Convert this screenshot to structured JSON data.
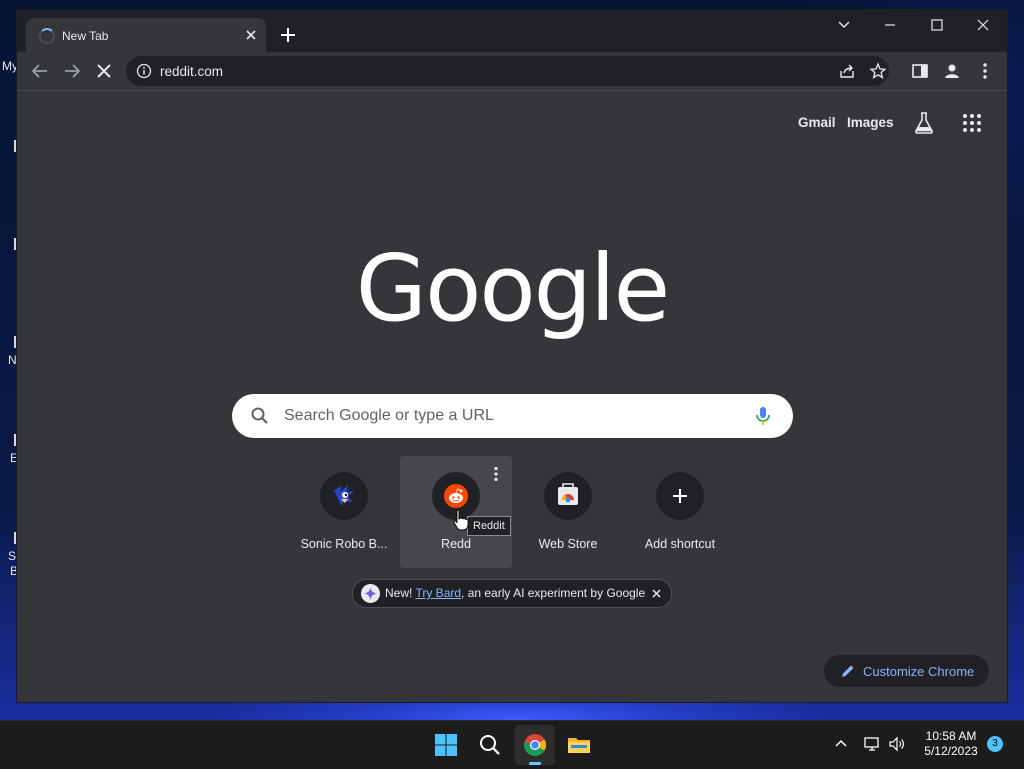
{
  "desktop": {
    "icon_label_fragments": [
      "My",
      "N",
      "E",
      "Sc",
      "B"
    ]
  },
  "browser": {
    "tab": {
      "title": "New Tab",
      "loading": true
    },
    "omnibox": {
      "url": "reddit.com"
    },
    "icons": {
      "back": "arrow-left-icon",
      "forward": "arrow-right-icon",
      "stop": "close-icon",
      "site_info": "info-icon",
      "share": "share-icon",
      "bookmark": "star-icon",
      "side_panel": "side-panel-icon",
      "profile": "profile-icon",
      "menu": "kebab-menu-icon"
    }
  },
  "ntp": {
    "top_links": {
      "gmail": "Gmail",
      "images": "Images"
    },
    "logo_text": "Google",
    "search": {
      "placeholder": "Search Google or type a URL"
    },
    "shortcuts": [
      {
        "label": "Sonic Robo B...",
        "icon": "sonic-favicon"
      },
      {
        "label": "Redd",
        "icon": "reddit-favicon",
        "hovered": true
      },
      {
        "label": "Web Store",
        "icon": "chrome-web-store-favicon"
      },
      {
        "label": "Add shortcut",
        "icon": "plus-icon"
      }
    ],
    "tooltip": "Reddit",
    "promo": {
      "prefix": "New!",
      "link": "Try Bard",
      "suffix": ", an early AI experiment by Google"
    },
    "customize_label": "Customize Chrome"
  },
  "taskbar": {
    "apps": [
      "windows-start",
      "search",
      "google-chrome",
      "file-explorer"
    ],
    "active_app": "google-chrome",
    "time": "10:58 AM",
    "date": "5/12/2023",
    "notification_count": "3"
  },
  "colors": {
    "chrome_dark": "#202124",
    "ntp_background": "#35363a",
    "link_blue": "#8ab4f8",
    "reddit_orange": "#ff4500"
  }
}
